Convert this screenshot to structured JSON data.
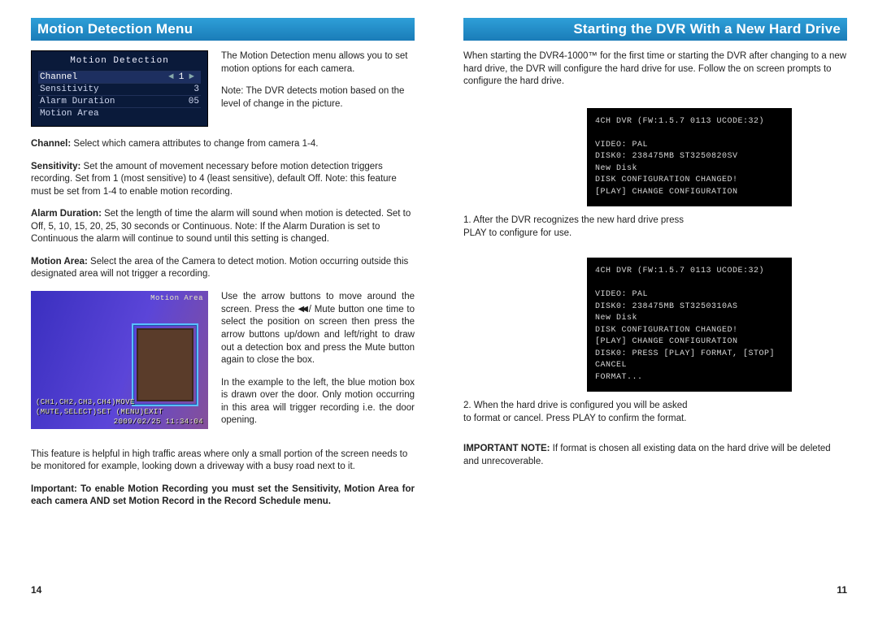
{
  "left": {
    "header": "Motion Detection Menu",
    "menu_title": "Motion Detection",
    "menu_rows": {
      "channel_label": "Channel",
      "channel_val": "1",
      "sensitivity_label": "Sensitivity",
      "sensitivity_val": "3",
      "alarm_label": "Alarm Duration",
      "alarm_val": "05",
      "area_label": "Motion Area"
    },
    "intro1": "The Motion Detection menu allows you to set motion options for each camera.",
    "intro2": "Note: The DVR detects motion based on the level of change in the picture.",
    "def_channel_label": "Channel:",
    "def_channel_text": "  Select which camera attributes to change from camera 1-4.",
    "def_sens_label": "Sensitivity:",
    "def_sens_text": "  Set the amount of movement necessary before motion detection triggers recording.  Set from 1 (most sensitive) to 4 (least sensitive), default Off.  Note: this feature must be set from 1-4 to enable motion recording.",
    "def_alarm_label": "Alarm Duration:",
    "def_alarm_text": "  Set the length of time the alarm will sound when motion is detected.  Set to Off, 5, 10, 15, 20, 25, 30 seconds or Continuous.  Note: If the Alarm Duration is set to Continuous the alarm will continue to sound until this setting is changed.",
    "def_area_label": "Motion Area:",
    "def_area_text": "  Select the area of the Camera to detect motion.  Motion occurring outside this designated area will not trigger a recording.",
    "motion_img_top": "Motion Area",
    "motion_img_cap1": "(CH1,CH2,CH3,CH4)MOVE",
    "motion_img_cap2": "(MUTE,SELECT)SET (MENU)EXIT",
    "motion_img_ts": "2009/02/25 11:34:04",
    "arrows_text_a": "Use the arrow buttons to move around the screen.  Press the ",
    "arrows_text_b": " / Mute button one time to select the position on screen then press the arrow buttons up/down and left/right to draw out a detection box and press the Mute button again to close the box.",
    "example_text": "In the example to the left, the blue motion box is drawn over the door.  Only motion occurring in this area will trigger recording i.e. the door opening.",
    "helpful_text": "This feature is helpful in high traffic areas where only a small portion of the screen needs to be monitored for example, looking down a driveway with a busy road next to it.",
    "important_text": "Important:  To enable Motion Recording you must set the Sensitivity,  Motion Area for each camera AND set Motion Record in the Record Schedule menu.",
    "page_num": "14"
  },
  "right": {
    "header": "Starting the DVR With a New Hard Drive",
    "intro": "When starting the DVR4-1000™ for the first time or starting the DVR after changing to a new hard drive, the DVR will configure the hard drive for use.  Follow the on screen prompts to configure the hard drive.",
    "term1": {
      "l1": "4CH DVR (FW:1.5.7 0113 UCODE:32)",
      "l2": "VIDEO: PAL",
      "l3": "DISK0: 238475MB ST3250820SV",
      "l4": "New Disk",
      "l5": "DISK CONFIGURATION CHANGED!",
      "l6": "[PLAY] CHANGE CONFIGURATION"
    },
    "cap1": "1.  After the DVR recognizes the new hard drive press PLAY to configure for use.",
    "term2": {
      "l1": "4CH DVR (FW:1.5.7 0113 UCODE:32)",
      "l2": "VIDEO: PAL",
      "l3": "DISK0: 238475MB ST3250310AS",
      "l4": "New Disk",
      "l5": "DISK CONFIGURATION CHANGED!",
      "l6": "[PLAY] CHANGE CONFIGURATION",
      "l7": "DISK0: PRESS [PLAY] FORMAT, [STOP] CANCEL",
      "l8": "FORMAT..."
    },
    "cap2": "2.  When the hard drive is configured you will be asked to format or cancel.  Press PLAY to confirm the format.",
    "note_label": "IMPORTANT NOTE:",
    "note_text": "  If format is chosen all existing data on the hard drive will be deleted and unrecoverable.",
    "page_num": "11"
  }
}
